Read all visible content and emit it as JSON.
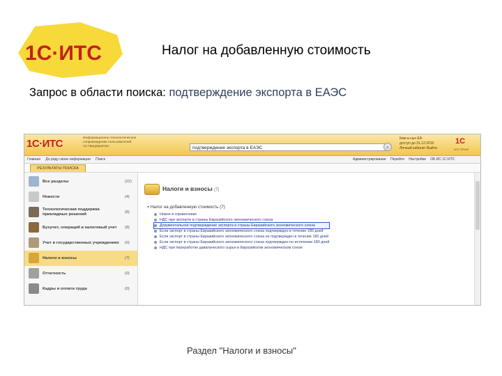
{
  "slide": {
    "title": "Налог на добавленную стоимость",
    "query_prefix": "Запрос в области поиска:",
    "query_value": "подтверждение экспорта в ЕАЭС",
    "caption": "Раздел \"Налоги и взносы\""
  },
  "logo": {
    "text": "1С·ИТС"
  },
  "app": {
    "header": {
      "logo": "1С·ИТС",
      "description": "Информационно-технологическое сопровождение пользователей 1С:Предприятия",
      "search_value": "подтверждение экспорта в ЕАЭС",
      "user_line1": "Ким-а-сын ЕА",
      "user_line2": "доступ до 31.12.2016",
      "user_line3": "Личный кабинет  Выйти",
      "logo2": "1С",
      "logo2_sub": "ИТС ПРОФ"
    },
    "menu_left": [
      "Главная",
      "До ряду своих информации",
      "Поиск"
    ],
    "menu_right": [
      "Администрирование",
      "Перейти",
      "Настройки",
      "ОБ ИС 1С:ИТС"
    ],
    "tab_active": "РЕЗУЛЬТАТЫ ПОИСКА",
    "sidebar": [
      {
        "label": "Все разделы",
        "count": "(22)",
        "active": false,
        "icon": "magnifier-icon",
        "color": "#9fb4cf"
      },
      {
        "label": "Новости",
        "count": "(4)",
        "active": false,
        "icon": "newspaper-icon",
        "color": "#c9c9c9"
      },
      {
        "label": "Технологическая поддержка прикладных решений",
        "count": "(8)",
        "active": false,
        "icon": "gear-icon",
        "color": "#7b6b56"
      },
      {
        "label": "Бухучет, операций и налоговый учет",
        "count": "(8)",
        "active": false,
        "icon": "ledger-icon",
        "color": "#8a6a3a"
      },
      {
        "label": "Учет в государственных учреждениях",
        "count": "(0)",
        "active": false,
        "icon": "building-icon",
        "color": "#b19a7a"
      },
      {
        "label": "Налоги и взносы",
        "count": "(7)",
        "active": true,
        "icon": "coins-icon",
        "color": "#d7a63a"
      },
      {
        "label": "Отчетность",
        "count": "(0)",
        "active": false,
        "icon": "report-icon",
        "color": "#a0a0a0"
      },
      {
        "label": "Кадры и оплата труда",
        "count": "(0)",
        "active": false,
        "icon": "people-icon",
        "color": "#8a8a8a"
      }
    ],
    "main": {
      "section_title": "Налоги и взносы",
      "section_count": "(7)",
      "tree_root": "Налог на добавленную стоимость (7)",
      "documents": [
        {
          "text": "Новое в справочнике",
          "highlight": false
        },
        {
          "text": "НДС при экспорте в страны Евразийского экономического союза",
          "highlight": false
        },
        {
          "text": "Документальное подтверждение экспорта в страны Евразийского экономического союза",
          "highlight": true
        },
        {
          "text": "Если экспорт в страны Евразийского экономического союза подтвержден в течение 180 дней",
          "highlight": false
        },
        {
          "text": "Если экспорт в страны Евразийского экономического союза не подтвержден в течение 180 дней",
          "highlight": false
        },
        {
          "text": "Если экспорт в страны Евразийского экономического союза подтвержден по истечении 180 дней",
          "highlight": false
        },
        {
          "text": "НДС при переработке давальческого сырья в Евразийском экономическом союзе",
          "highlight": false
        }
      ]
    }
  }
}
